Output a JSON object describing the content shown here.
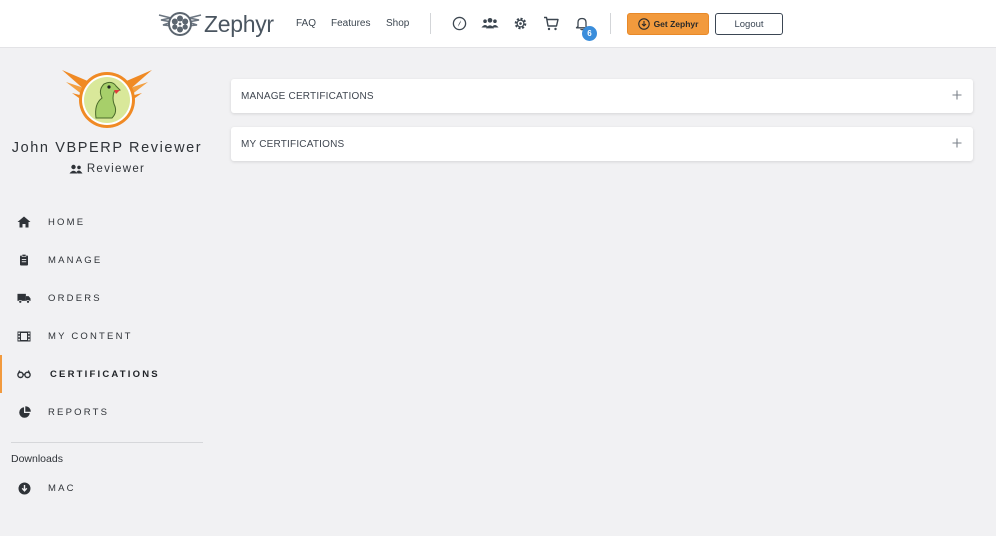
{
  "header": {
    "brand": "Zephyr",
    "nav_links": [
      "FAQ",
      "Features",
      "Shop"
    ],
    "notification_count": "6",
    "get_button_label": "Get Zephyr",
    "logout_label": "Logout",
    "accent_color": "#f29a3d",
    "badge_color": "#3a8ddb"
  },
  "profile": {
    "name": "John VBPERP Reviewer",
    "role": "Reviewer"
  },
  "sidebar": {
    "items": [
      {
        "label": "HOME",
        "icon": "home-icon"
      },
      {
        "label": "MANAGE",
        "icon": "clipboard-icon"
      },
      {
        "label": "ORDERS",
        "icon": "truck-icon"
      },
      {
        "label": "MY CONTENT",
        "icon": "film-icon"
      },
      {
        "label": "CERTIFICATIONS",
        "icon": "glasses-icon",
        "active": true
      },
      {
        "label": "REPORTS",
        "icon": "pie-chart-icon"
      }
    ],
    "downloads_title": "Downloads",
    "downloads": [
      {
        "label": "MAC",
        "icon": "download-circle-icon"
      }
    ]
  },
  "main": {
    "panels": [
      {
        "title": "MANAGE CERTIFICATIONS"
      },
      {
        "title": "MY CERTIFICATIONS"
      }
    ]
  }
}
